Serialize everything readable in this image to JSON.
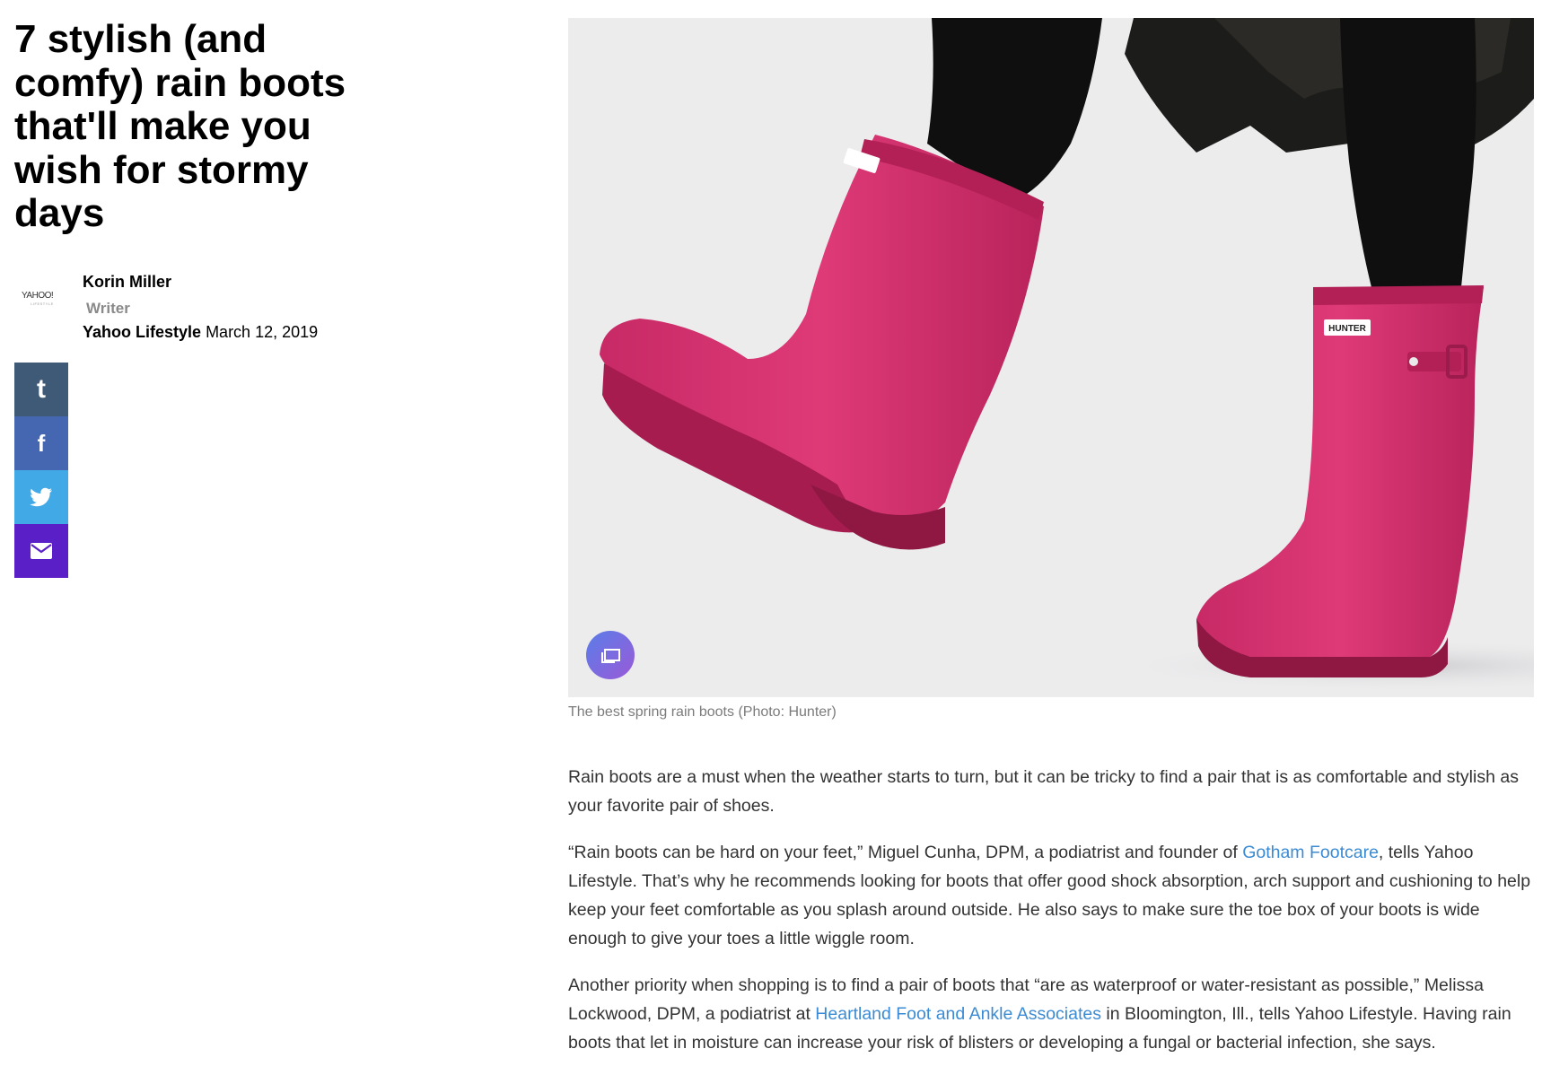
{
  "article": {
    "headline": "7 stylish (and comfy) rain boots that'll make you wish for stormy days"
  },
  "byline": {
    "logo_text": "YAHOO!",
    "logo_subtext": "LIFESTYLE",
    "author_name": "Korin Miller",
    "author_role": "Writer",
    "publisher": "Yahoo Lifestyle",
    "date": "March 12, 2019"
  },
  "share": {
    "tumblr_glyph": "t",
    "facebook_glyph": "f"
  },
  "hero_image": {
    "boot_brand_label": "HUNTER",
    "caption": "The best spring rain boots (Photo: Hunter)"
  },
  "body": {
    "p1": "Rain boots are a must when the weather starts to turn, but it can be tricky to find a pair that is as comfortable and stylish as your favorite pair of shoes.",
    "p2_before": "“Rain boots can be hard on your feet,” Miguel Cunha, DPM, a podiatrist and founder of ",
    "p2_link": "Gotham Footcare",
    "p2_after": ", tells Yahoo Lifestyle. That’s why he recommends looking for boots that offer good shock absorption, arch support and cushioning to help keep your feet comfortable as you splash around outside. He also says to make sure the toe box of your boots is wide enough to give your toes a little wiggle room.",
    "p3_before": "Another priority when shopping is to find a pair of boots that “are as waterproof or water-resistant as possible,” Melissa Lockwood, DPM, a podiatrist at ",
    "p3_link": "Heartland Foot and Ankle Associates",
    "p3_after": " in Bloomington, Ill., tells Yahoo Lifestyle. Having rain boots that let in moisture can increase your risk of blisters or developing a fungal or bacterial infection, she says."
  },
  "colors": {
    "boot_pink": "#d6336f",
    "tumblr": "#3e5a76",
    "facebook": "#4566b0",
    "twitter": "#41a9e6",
    "mail": "#5a1fc6",
    "link": "#3b8bd4"
  }
}
